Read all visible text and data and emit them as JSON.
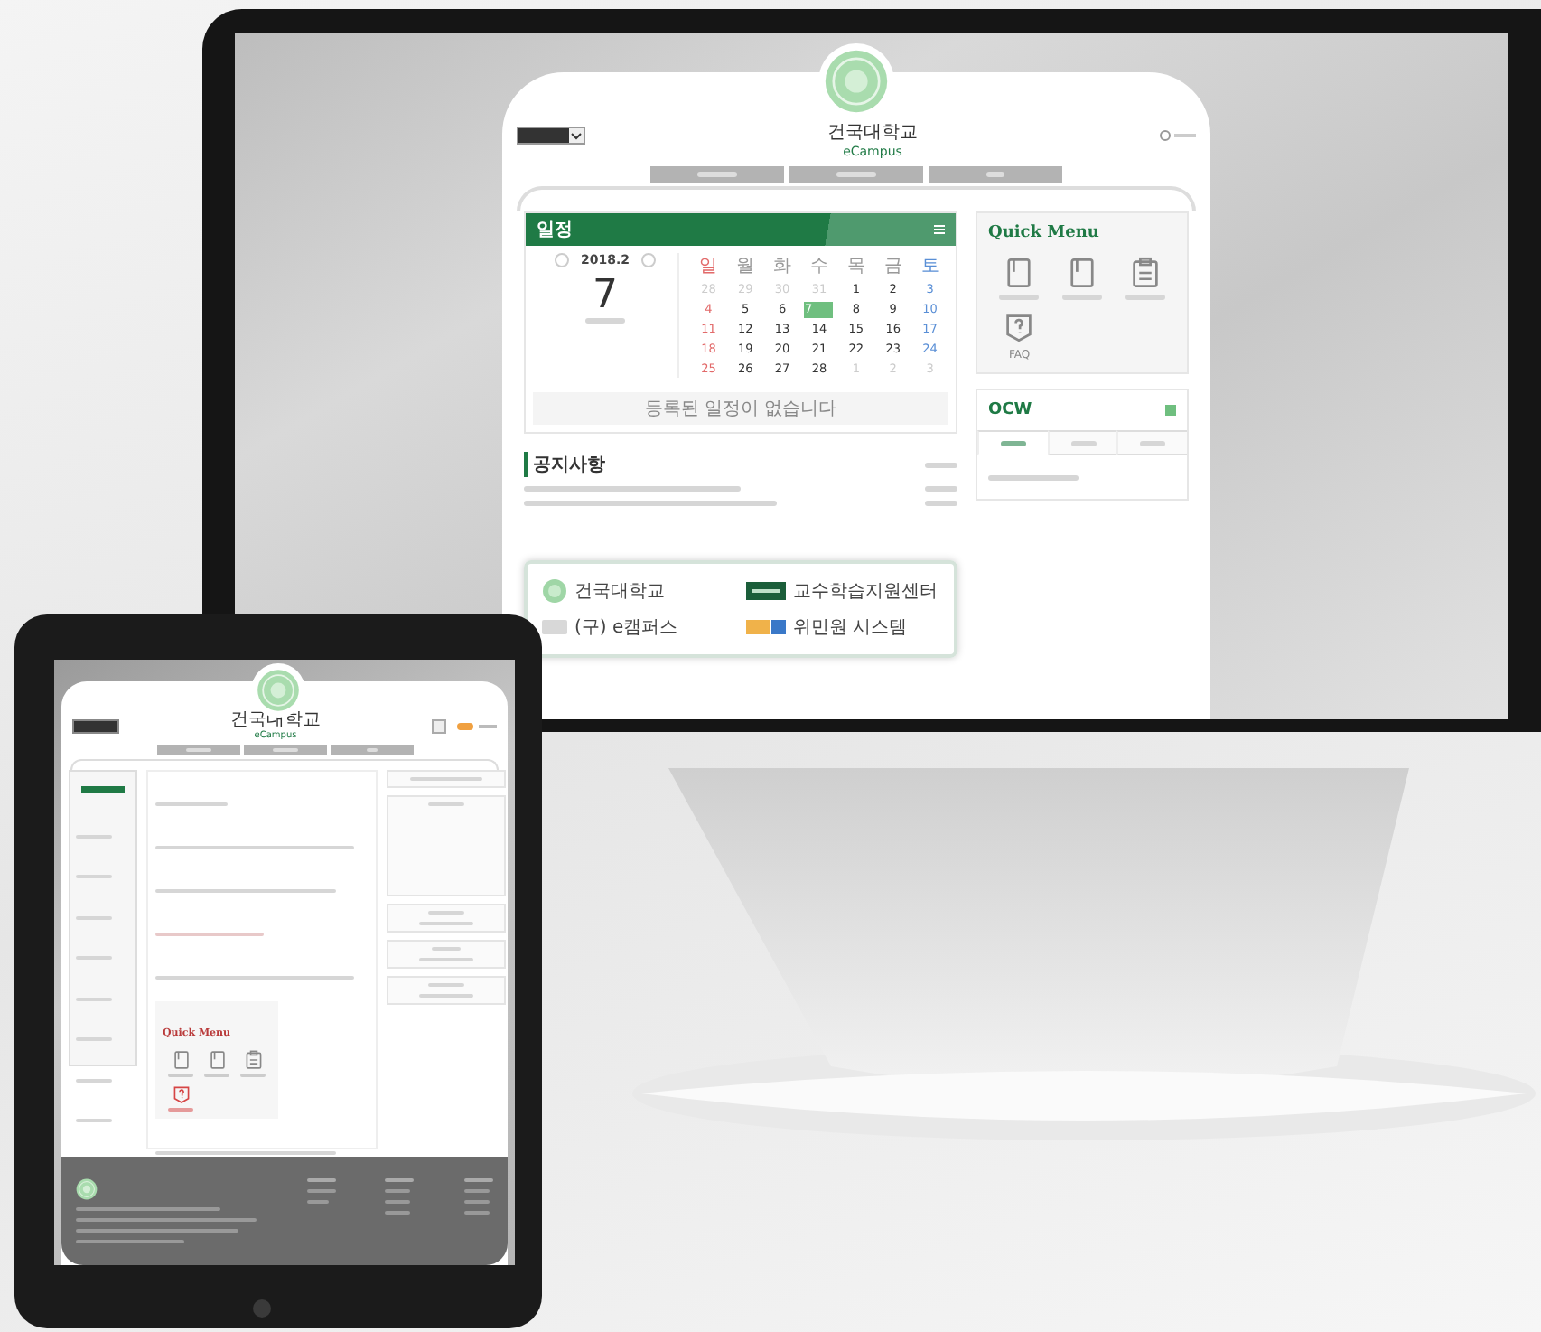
{
  "monitor": {
    "site": {
      "university": "건국대학교",
      "brand": "eCampus"
    },
    "schedule": {
      "title": "일정",
      "month": "2018.2",
      "day": "7",
      "weekdays": [
        "일",
        "월",
        "화",
        "수",
        "목",
        "금",
        "토"
      ],
      "dates": [
        {
          "d": "28",
          "muted": true,
          "selected": false
        },
        {
          "d": "29",
          "muted": true,
          "selected": false
        },
        {
          "d": "30",
          "muted": true,
          "selected": false
        },
        {
          "d": "31",
          "muted": true,
          "selected": false
        },
        {
          "d": "1",
          "muted": false,
          "selected": false
        },
        {
          "d": "2",
          "muted": false,
          "selected": false
        },
        {
          "d": "3",
          "muted": false,
          "selected": false
        },
        {
          "d": "4",
          "muted": false,
          "selected": false
        },
        {
          "d": "5",
          "muted": false,
          "selected": false
        },
        {
          "d": "6",
          "muted": false,
          "selected": false
        },
        {
          "d": "7",
          "muted": false,
          "selected": true
        },
        {
          "d": "8",
          "muted": false,
          "selected": false
        },
        {
          "d": "9",
          "muted": false,
          "selected": false
        },
        {
          "d": "10",
          "muted": false,
          "selected": false
        },
        {
          "d": "11",
          "muted": false,
          "selected": false
        },
        {
          "d": "12",
          "muted": false,
          "selected": false
        },
        {
          "d": "13",
          "muted": false,
          "selected": false
        },
        {
          "d": "14",
          "muted": false,
          "selected": false
        },
        {
          "d": "15",
          "muted": false,
          "selected": false
        },
        {
          "d": "16",
          "muted": false,
          "selected": false
        },
        {
          "d": "17",
          "muted": false,
          "selected": false
        },
        {
          "d": "18",
          "muted": false,
          "selected": false
        },
        {
          "d": "19",
          "muted": false,
          "selected": false
        },
        {
          "d": "20",
          "muted": false,
          "selected": false
        },
        {
          "d": "21",
          "muted": false,
          "selected": false
        },
        {
          "d": "22",
          "muted": false,
          "selected": false
        },
        {
          "d": "23",
          "muted": false,
          "selected": false
        },
        {
          "d": "24",
          "muted": false,
          "selected": false
        },
        {
          "d": "25",
          "muted": false,
          "selected": false
        },
        {
          "d": "26",
          "muted": false,
          "selected": false
        },
        {
          "d": "27",
          "muted": false,
          "selected": false
        },
        {
          "d": "28",
          "muted": false,
          "selected": false
        },
        {
          "d": "1",
          "muted": true,
          "selected": false
        },
        {
          "d": "2",
          "muted": true,
          "selected": false
        },
        {
          "d": "3",
          "muted": true,
          "selected": false
        }
      ],
      "empty_message": "등록된 일정이 없습니다"
    },
    "quick_menu": {
      "title": "Quick Menu",
      "items": [
        {
          "kind": "document"
        },
        {
          "kind": "document"
        },
        {
          "kind": "clipboard"
        },
        {
          "kind": "faq",
          "label": "FAQ"
        }
      ]
    },
    "ocw": {
      "title": "OCW",
      "tabs": [
        {
          "selected": true
        },
        {
          "selected": false
        },
        {
          "selected": false
        }
      ]
    },
    "notices": {
      "title": "공지사항"
    },
    "links": [
      {
        "kind": "seal",
        "label": "건국대학교"
      },
      {
        "kind": "badge",
        "label": "교수학습지원센터"
      },
      {
        "kind": "wordmark",
        "label": "(구) e캠퍼스"
      },
      {
        "kind": "tag",
        "label": "위민원 시스템"
      }
    ]
  },
  "tablet": {
    "site": {
      "university": "건국대학교",
      "brand": "eCampus"
    },
    "quick_menu": {
      "title": "Quick Menu",
      "items": [
        {
          "kind": "document",
          "highlighted": false
        },
        {
          "kind": "document",
          "highlighted": false
        },
        {
          "kind": "clipboard",
          "highlighted": false
        },
        {
          "kind": "faq",
          "highlighted": true
        }
      ]
    }
  }
}
